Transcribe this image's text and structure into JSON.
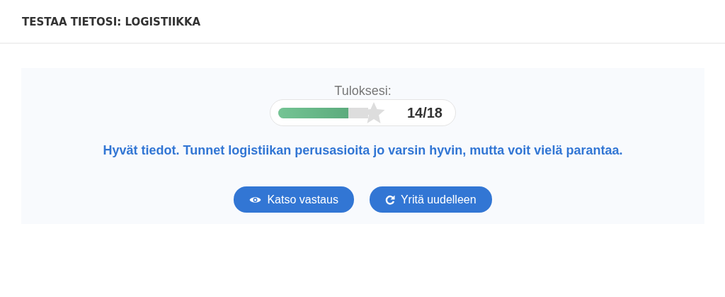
{
  "header": {
    "title": "TESTAA TIETOSI: LOGISTIIKKA"
  },
  "result": {
    "label": "Tuloksesi:",
    "level": 0.78,
    "score": "14/18",
    "message": "Hyvät tiedot. Tunnet logistiikan perusasioita jo varsin hyvin, mutta voit vielä parantaa."
  },
  "buttons": [
    {
      "label": "Katso vastaus",
      "kind": "view"
    },
    {
      "label": "Yritä uudelleen",
      "kind": "retry"
    }
  ]
}
